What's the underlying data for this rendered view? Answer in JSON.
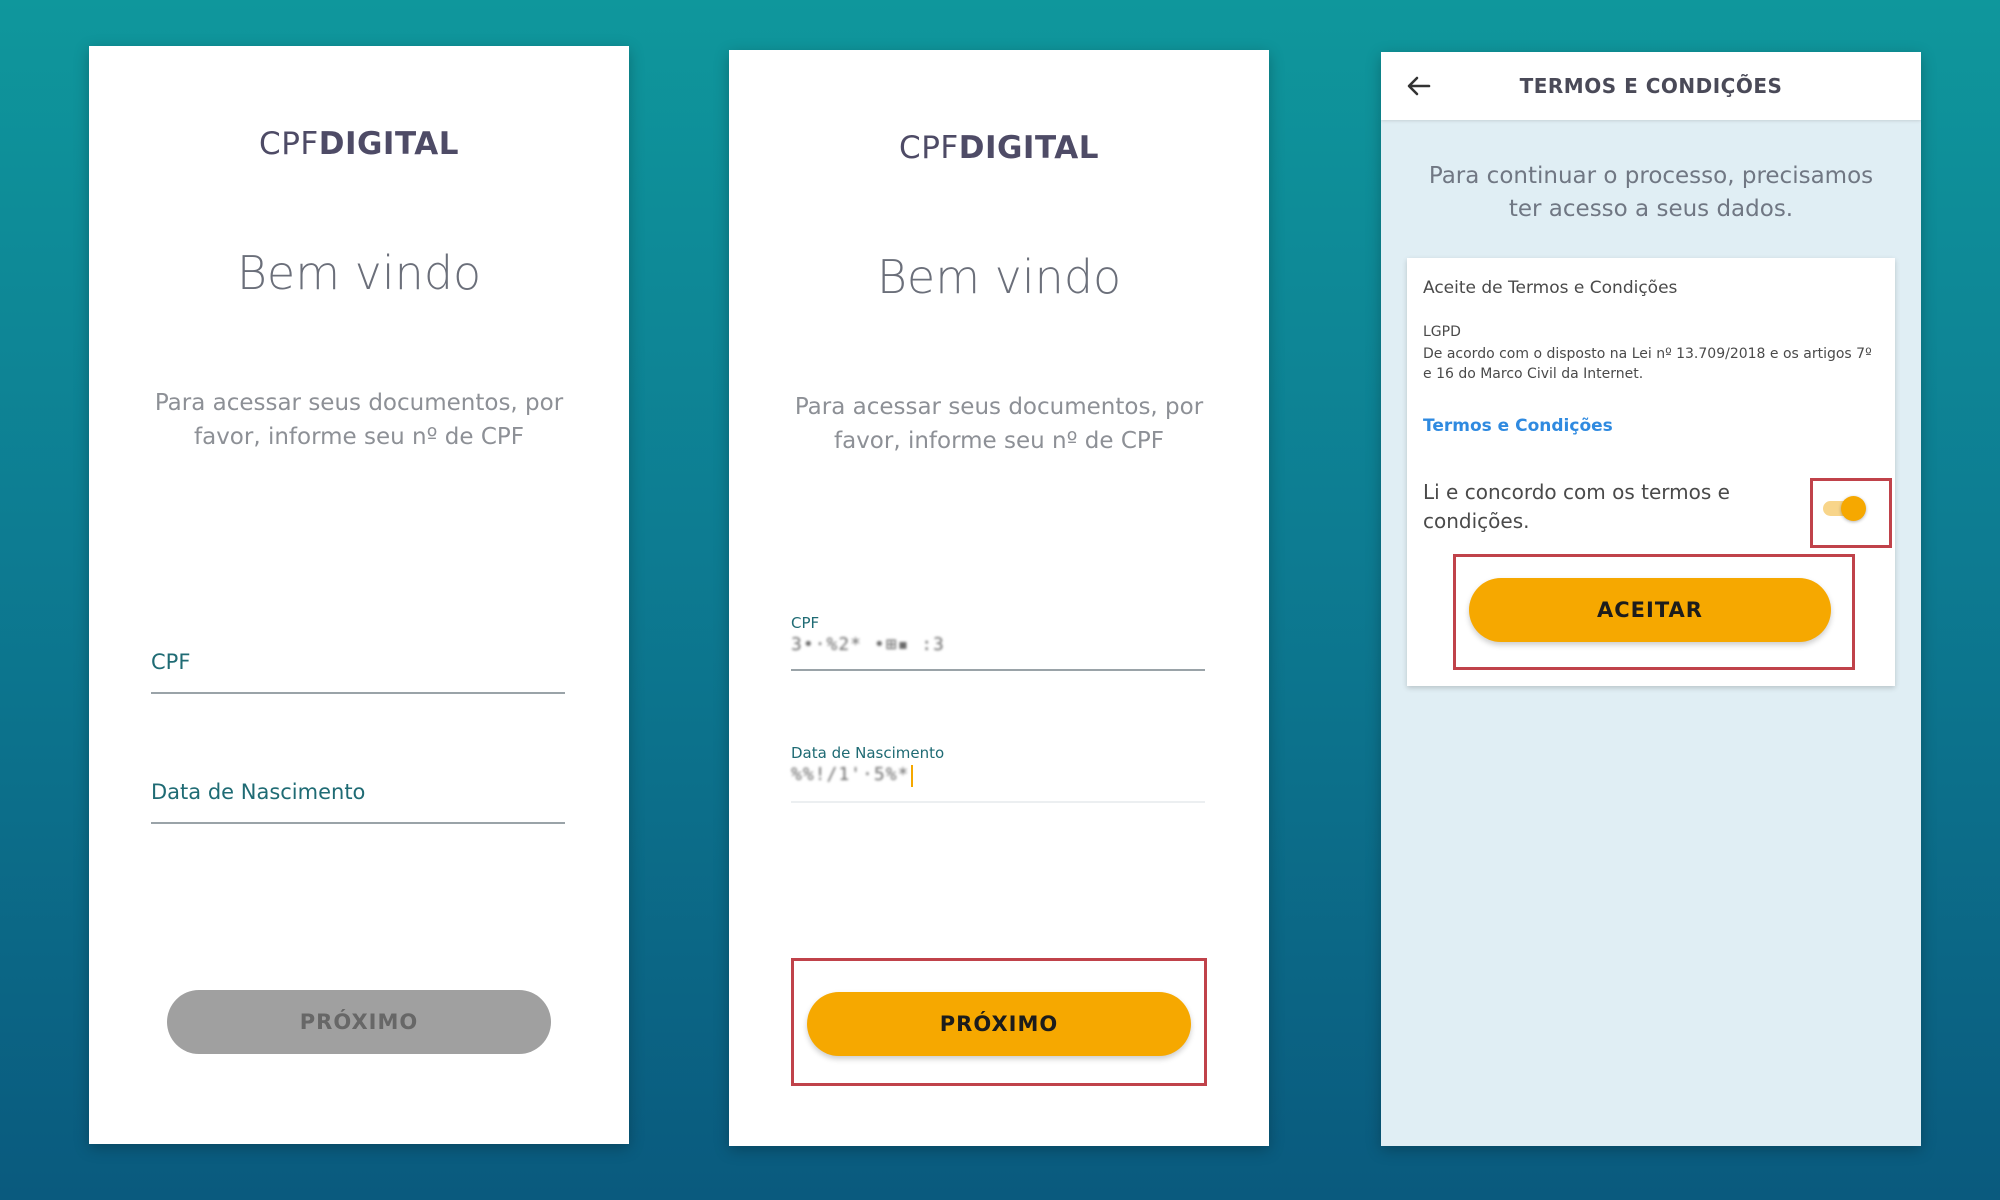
{
  "screen1": {
    "logo_light": "CPF",
    "logo_bold": "DIGITAL",
    "welcome": "Bem vindo",
    "instruction": "Para acessar seus documentos, por favor, informe seu nº de CPF",
    "cpf_label": "CPF",
    "dob_label": "Data de Nascimento",
    "next_button": "PRÓXIMO"
  },
  "screen2": {
    "logo_light": "CPF",
    "logo_bold": "DIGITAL",
    "welcome": "Bem vindo",
    "instruction": "Para acessar seus documentos, por favor, informe seu nº de CPF",
    "cpf_label": "CPF",
    "cpf_value": "3•·%2* •⊞▪ :3",
    "dob_label": "Data de Nascimento",
    "dob_value": "%%!/1'·5%*",
    "next_button": "PRÓXIMO"
  },
  "screen3": {
    "title": "TERMOS E CONDIÇÕES",
    "back_icon": "arrow-left-icon",
    "intro": "Para continuar o processo, precisamos ter acesso a seus dados.",
    "card": {
      "title": "Aceite de Termos e Condições",
      "lgpd": "LGPD",
      "text": "De acordo com o disposto na Lei nº 13.709/2018 e os artigos 7º e 16 do Marco Civil da Internet.",
      "link": "Termos e Condições",
      "agree": "Li e concordo com os termos e condições.",
      "toggle_on": true,
      "accept_button": "ACEITAR"
    }
  },
  "colors": {
    "accent": "#f6a800",
    "highlight": "#c0424a",
    "link": "#2f8ae0",
    "label": "#1f6b74"
  }
}
